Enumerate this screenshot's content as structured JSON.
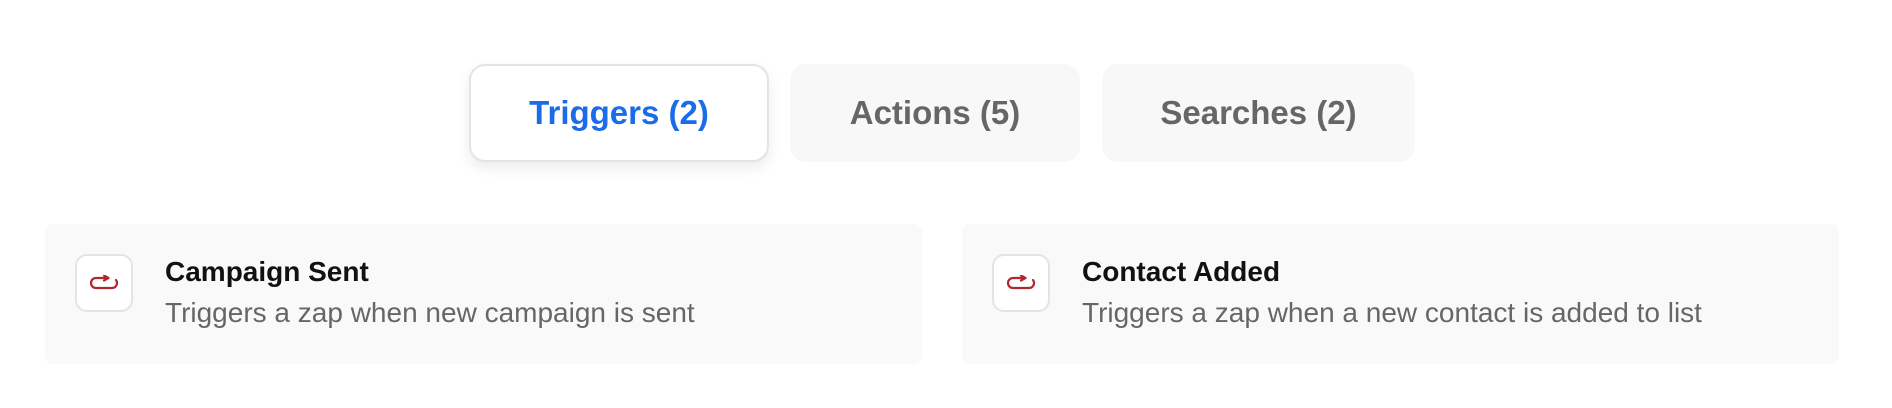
{
  "tabs": [
    {
      "label": "Triggers (2)",
      "active": true
    },
    {
      "label": "Actions (5)",
      "active": false
    },
    {
      "label": "Searches (2)",
      "active": false
    }
  ],
  "cards": [
    {
      "title": "Campaign Sent",
      "description": "Triggers a zap when new campaign is sent",
      "icon": "trigger-loop-icon"
    },
    {
      "title": "Contact Added",
      "description": "Triggers a zap when a new contact is added to list",
      "icon": "trigger-loop-icon"
    }
  ],
  "colors": {
    "active_tab_text": "#1a6ce8",
    "inactive_tab_text": "#666666",
    "icon_color": "#b0272f"
  }
}
